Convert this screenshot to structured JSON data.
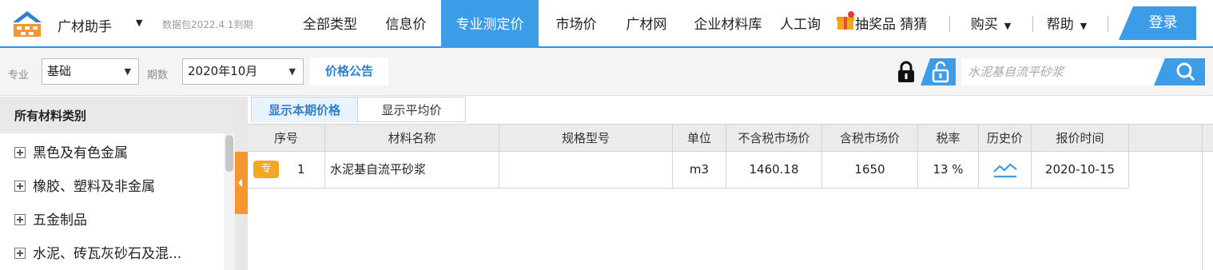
{
  "header": {
    "app_title": "广材助手",
    "version_info": "数据包2022.4.1到期",
    "nav_items": [
      "全部类型",
      "信息价",
      "专业测定价",
      "市场价",
      "广材网",
      "企业材料库",
      "人工询"
    ],
    "active_nav": "专业测定价",
    "gift_text": "​抽奖品 猜猜",
    "buy_label": "购买",
    "help_label": "帮助",
    "login_label": "登录",
    "brand_color": "#3d9ce8"
  },
  "filters": {
    "specialty_label": "专业",
    "specialty_value": "基础",
    "period_label": "期数",
    "period_value": "2020年10月",
    "announcement_label": "价格公告",
    "search_placeholder": "水泥基自流平砂浆"
  },
  "sidebar": {
    "header": "所有材料类别",
    "items": [
      {
        "label": "黑色及有色金属"
      },
      {
        "label": "橡胶、塑料及非金属"
      },
      {
        "label": "五金制品"
      },
      {
        "label": "水泥、砖瓦灰砂石及混..."
      }
    ]
  },
  "content": {
    "tabs": [
      {
        "label": "显示本期价格",
        "active": true
      },
      {
        "label": "显示平均价",
        "active": false
      }
    ],
    "columns": [
      "序号",
      "材料名称",
      "规格型号",
      "单位",
      "不含税市场价",
      "含税市场价",
      "税率",
      "历史价",
      "报价时间"
    ],
    "rows": [
      {
        "badge": "专",
        "index": "1",
        "name": "水泥基自流平砂浆",
        "spec": "",
        "unit": "m3",
        "price_ex_tax": "1460.18",
        "price_inc_tax": "1650",
        "tax_rate": "13 %",
        "history_icon": "line-chart-icon",
        "quote_date": "2020-10-15"
      }
    ]
  }
}
